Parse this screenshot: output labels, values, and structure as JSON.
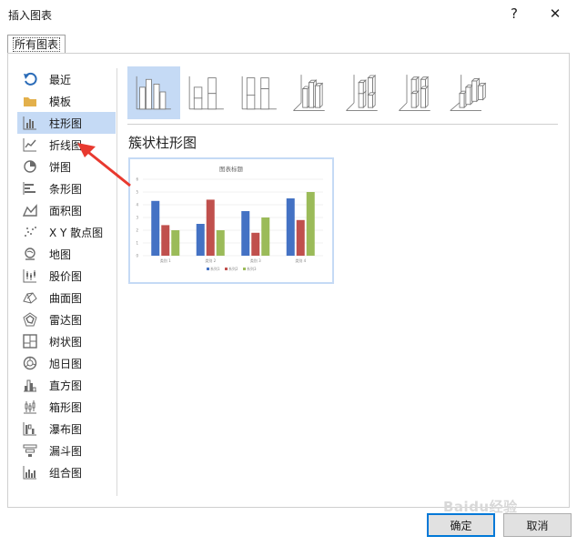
{
  "window": {
    "title": "插入图表",
    "help_glyph": "?",
    "close_glyph": "✕"
  },
  "tab": {
    "label": "所有图表"
  },
  "sidebar": {
    "items": [
      {
        "label": "最近",
        "icon": "recent-icon",
        "selected": false
      },
      {
        "label": "模板",
        "icon": "folder-icon",
        "selected": false
      },
      {
        "label": "柱形图",
        "icon": "column-chart-icon",
        "selected": true
      },
      {
        "label": "折线图",
        "icon": "line-chart-icon",
        "selected": false
      },
      {
        "label": "饼图",
        "icon": "pie-chart-icon",
        "selected": false
      },
      {
        "label": "条形图",
        "icon": "bar-chart-icon",
        "selected": false
      },
      {
        "label": "面积图",
        "icon": "area-chart-icon",
        "selected": false
      },
      {
        "label": "X Y 散点图",
        "icon": "scatter-chart-icon",
        "selected": false
      },
      {
        "label": "地图",
        "icon": "map-chart-icon",
        "selected": false
      },
      {
        "label": "股价图",
        "icon": "stock-chart-icon",
        "selected": false
      },
      {
        "label": "曲面图",
        "icon": "surface-chart-icon",
        "selected": false
      },
      {
        "label": "雷达图",
        "icon": "radar-chart-icon",
        "selected": false
      },
      {
        "label": "树状图",
        "icon": "treemap-chart-icon",
        "selected": false
      },
      {
        "label": "旭日图",
        "icon": "sunburst-chart-icon",
        "selected": false
      },
      {
        "label": "直方图",
        "icon": "histogram-chart-icon",
        "selected": false
      },
      {
        "label": "箱形图",
        "icon": "boxwhisker-chart-icon",
        "selected": false
      },
      {
        "label": "瀑布图",
        "icon": "waterfall-chart-icon",
        "selected": false
      },
      {
        "label": "漏斗图",
        "icon": "funnel-chart-icon",
        "selected": false
      },
      {
        "label": "组合图",
        "icon": "combo-chart-icon",
        "selected": false
      }
    ]
  },
  "subtypes": {
    "items": [
      {
        "icon": "clustered-column-icon",
        "selected": true
      },
      {
        "icon": "stacked-column-icon",
        "selected": false
      },
      {
        "icon": "100-stacked-column-icon",
        "selected": false
      },
      {
        "icon": "3d-clustered-column-icon",
        "selected": false
      },
      {
        "icon": "3d-stacked-column-icon",
        "selected": false
      },
      {
        "icon": "3d-100-stacked-column-icon",
        "selected": false
      },
      {
        "icon": "3d-column-icon",
        "selected": false
      }
    ],
    "selected_name": "簇状柱形图"
  },
  "chart_data": {
    "type": "bar",
    "title": "图表标题",
    "categories": [
      "类别 1",
      "类别 2",
      "类别 3",
      "类别 4"
    ],
    "series": [
      {
        "name": "系列1",
        "values": [
          4.3,
          2.5,
          3.5,
          4.5
        ]
      },
      {
        "name": "系列2",
        "values": [
          2.4,
          4.4,
          1.8,
          2.8
        ]
      },
      {
        "name": "系列3",
        "values": [
          2,
          2,
          3,
          5
        ]
      }
    ],
    "ylim": [
      0,
      6
    ],
    "y_ticks": [
      "0",
      "1",
      "2",
      "3",
      "4",
      "5",
      "6"
    ],
    "grid": true,
    "legend_position": "bottom",
    "colors": [
      "#4472c4",
      "#c0504d",
      "#9bbb59"
    ]
  },
  "footer": {
    "ok_label": "确定",
    "cancel_label": "取消"
  },
  "watermark": "Baidu经验"
}
